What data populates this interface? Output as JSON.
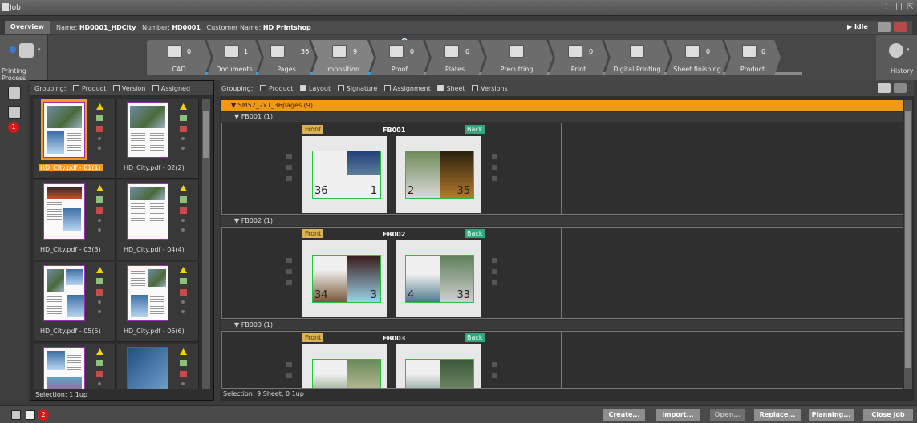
{
  "window": {
    "title": "Job"
  },
  "infobar": {
    "tab": "Overview",
    "name_label": "Name:",
    "name": "HD0001_HDCity",
    "number_label": "Number:",
    "number": "HD0001",
    "customer_label": "Customer Name:",
    "customer": "HD Printshop",
    "status": "Idle"
  },
  "process": {
    "left_button": "Printing Process",
    "history_button": "History",
    "steps": [
      {
        "label": "CAD",
        "count": "0"
      },
      {
        "label": "Documents",
        "count": "1"
      },
      {
        "label": "Pages",
        "count": "36"
      },
      {
        "label": "Imposition",
        "count": "9"
      },
      {
        "label": "Proof",
        "count": "0"
      },
      {
        "label": "Plates",
        "count": "0"
      },
      {
        "label": "Precutting",
        "count": ""
      },
      {
        "label": "Print",
        "count": "0"
      },
      {
        "label": "Digital Printing",
        "count": ""
      },
      {
        "label": "Sheet finishing",
        "count": "0"
      },
      {
        "label": "Product",
        "count": "0"
      }
    ]
  },
  "badges": {
    "one": "1",
    "two": "2"
  },
  "pagepanel": {
    "grouping_label": "Grouping:",
    "opt_product": "Product",
    "opt_version": "Version",
    "opt_assigned": "Assigned",
    "thumbs": [
      "HD_City.pdf - 01(1)",
      "HD_City.pdf - 02(2)",
      "HD_City.pdf - 03(3)",
      "HD_City.pdf - 04(4)",
      "HD_City.pdf - 05(5)",
      "HD_City.pdf - 06(6)"
    ],
    "status": "Selection:  1 1up"
  },
  "sheetarea": {
    "grouping_label": "Grouping:",
    "opt_product": "Product",
    "opt_layout": "Layout",
    "opt_signature": "Signature",
    "opt_assignment": "Assignment",
    "opt_sheet": "Sheet",
    "opt_versions": "Versions",
    "group": "SM52_2x1_36pages (9)",
    "front": "Front",
    "back": "Back",
    "sheets": [
      {
        "head": "FB001 (1)",
        "name": "FB001",
        "front_nums": [
          "36",
          "1"
        ],
        "back_nums": [
          "2",
          "35"
        ]
      },
      {
        "head": "FB002 (1)",
        "name": "FB002",
        "front_nums": [
          "34",
          "3"
        ],
        "back_nums": [
          "4",
          "33"
        ]
      },
      {
        "head": "FB003 (1)",
        "name": "FB003",
        "front_nums": [
          "",
          ""
        ],
        "back_nums": [
          "",
          ""
        ]
      }
    ],
    "status": "Selection:  9 Sheet,  0 1up"
  },
  "bottom": {
    "buttons": [
      "Create...",
      "Import...",
      "Open...",
      "Replace...",
      "Planning...",
      "Close Job"
    ]
  },
  "colors": {
    "accent_orange": "#f09a12",
    "progress_blue": "#32a0e6",
    "badge_red": "#d7191c",
    "frame_green": "#25c23f"
  }
}
